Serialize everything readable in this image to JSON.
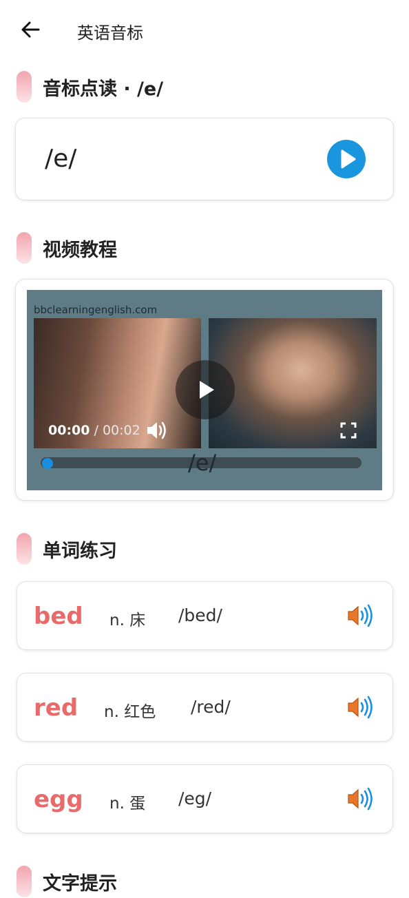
{
  "header": {
    "title": "英语音标",
    "back_icon": "arrow-left-icon"
  },
  "sections": {
    "phonetic_title": "音标点读 · /e/",
    "video_title": "视频教程",
    "practice_title": "单词练习",
    "tips_title": "文字提示"
  },
  "phonetic_card": {
    "symbol": "/e/",
    "play_color": "#1a96df"
  },
  "video": {
    "site": "bbclearningenglish.com",
    "current_time": "00:00",
    "separator": " / ",
    "duration": "00:02",
    "progress": 0,
    "caption": "/e/"
  },
  "words": [
    {
      "word": "bed",
      "meaning": "n. 床",
      "phonetic": "/bed/"
    },
    {
      "word": "red",
      "meaning": "n. 红色",
      "phonetic": "/red/"
    },
    {
      "word": "egg",
      "meaning": "n. 蛋",
      "phonetic": "/eg/"
    }
  ],
  "colors": {
    "accent": "#e86a6a",
    "play": "#1a96df",
    "pill": "#f2a4ad"
  }
}
